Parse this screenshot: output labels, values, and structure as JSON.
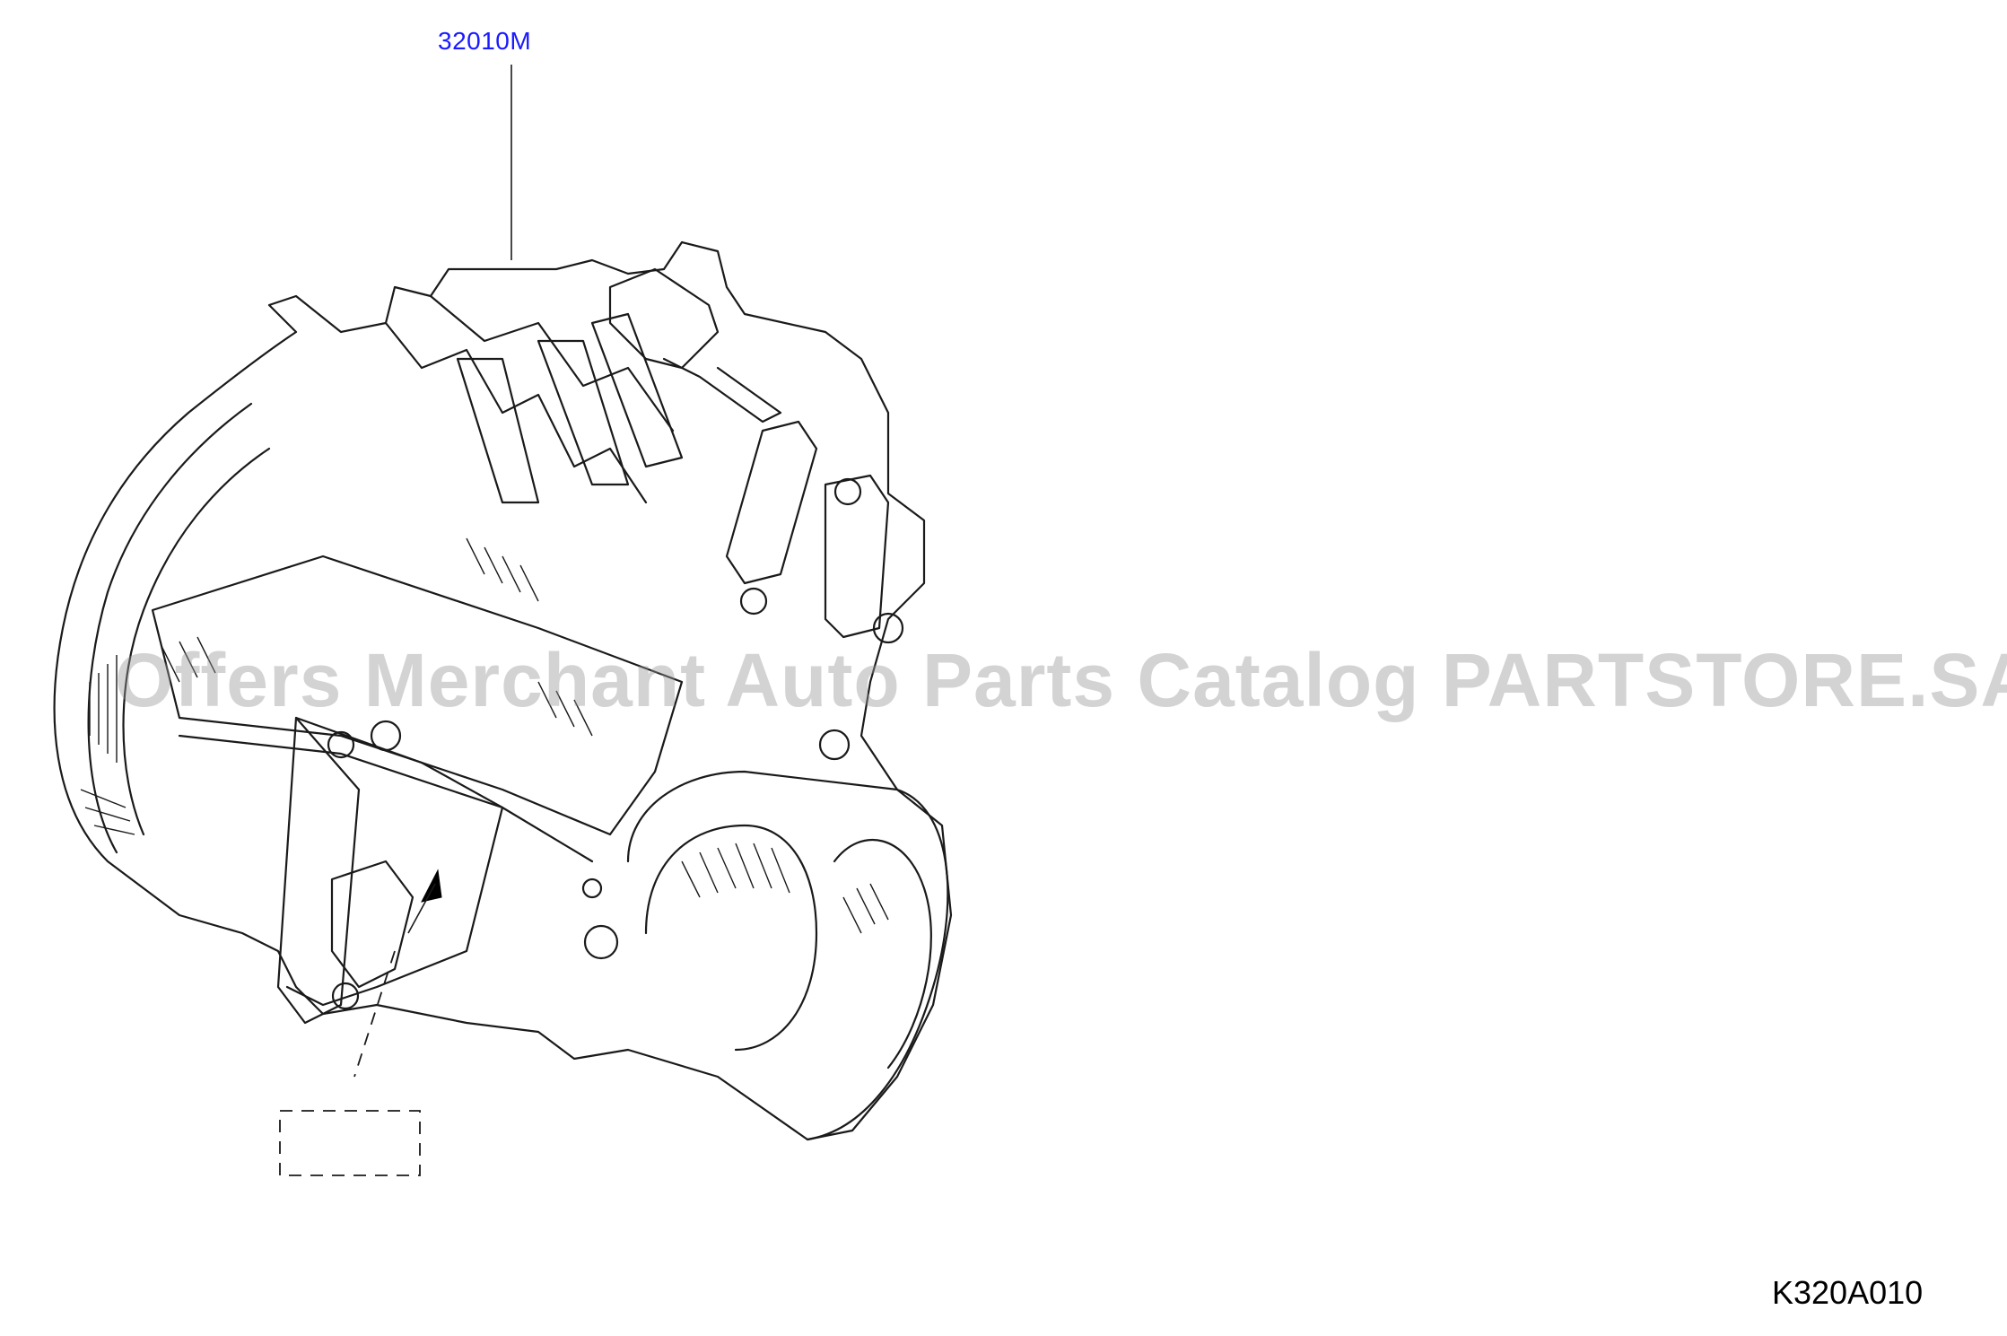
{
  "diagram": {
    "part_reference": "32010M",
    "illustration_code": "K320A010",
    "watermark": "Offers Merchant Auto Parts Catalog PARTSTORE.SA",
    "link_color": "#1a1aff"
  }
}
